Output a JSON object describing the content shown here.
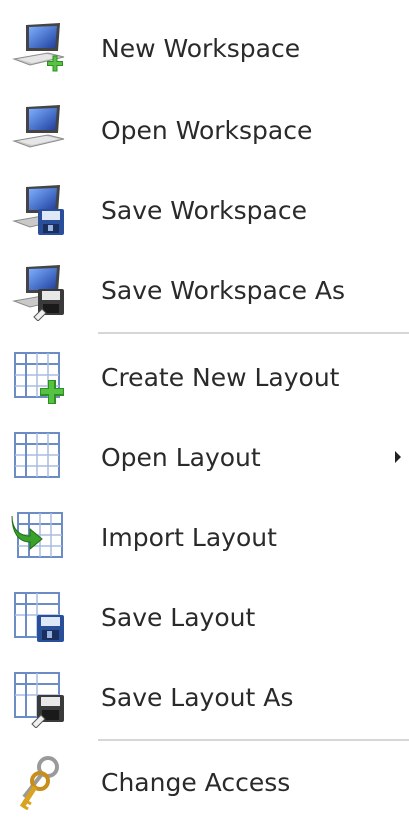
{
  "menu": {
    "items": [
      {
        "label": "New Workspace",
        "icon": "new-workspace-icon"
      },
      {
        "label": "Open Workspace",
        "icon": "open-workspace-icon"
      },
      {
        "label": "Save Workspace",
        "icon": "save-workspace-icon"
      },
      {
        "label": "Save Workspace As",
        "icon": "save-workspace-as-icon"
      },
      {
        "label": "Create New Layout",
        "icon": "create-layout-icon"
      },
      {
        "label": "Open Layout",
        "icon": "open-layout-icon",
        "has_submenu": true
      },
      {
        "label": "Import Layout",
        "icon": "import-layout-icon"
      },
      {
        "label": "Save Layout",
        "icon": "save-layout-icon"
      },
      {
        "label": "Save Layout As",
        "icon": "save-layout-as-icon"
      },
      {
        "label": "Change Access",
        "icon": "keys-icon"
      }
    ]
  },
  "colors": {
    "text": "#2a2a2a",
    "separator": "#d6d6d6",
    "green_plus": "#3aa12a",
    "monitor_blue": "#2f5fc0",
    "grid_blue": "#6b8cc4"
  }
}
